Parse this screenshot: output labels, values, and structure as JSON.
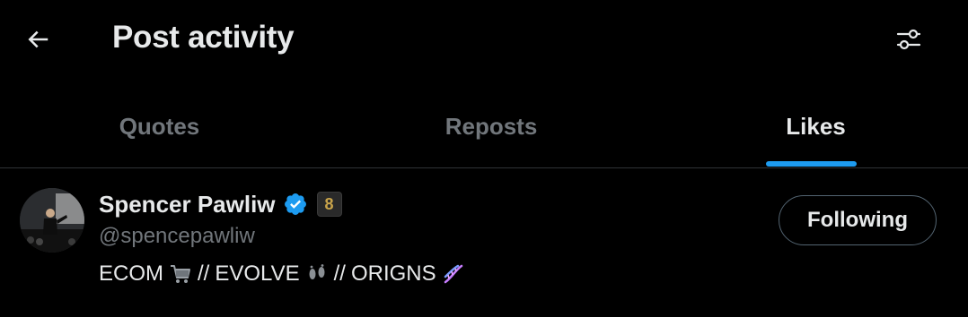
{
  "header": {
    "title": "Post activity",
    "back_icon": "arrow-left-icon",
    "filter_icon": "sliders-icon"
  },
  "tabs": [
    {
      "label": "Quotes",
      "active": false
    },
    {
      "label": "Reposts",
      "active": false
    },
    {
      "label": "Likes",
      "active": true
    }
  ],
  "colors": {
    "background": "#000000",
    "text_primary": "#e7e9ea",
    "text_secondary": "#71767b",
    "accent": "#1d9bf0",
    "divider": "#2f3336"
  },
  "user": {
    "display_name": "Spencer Pawliw",
    "handle": "@spencepawliw",
    "verified": true,
    "verified_icon": "verified-badge-icon",
    "affiliate_badge": "8",
    "bio": {
      "segments": [
        "ECOM",
        "//",
        "EVOLVE",
        "//",
        "ORIGNS"
      ],
      "icons": [
        "shopping-cart-icon",
        "footprints-icon",
        "dna-icon"
      ]
    },
    "follow_button_label": "Following"
  }
}
